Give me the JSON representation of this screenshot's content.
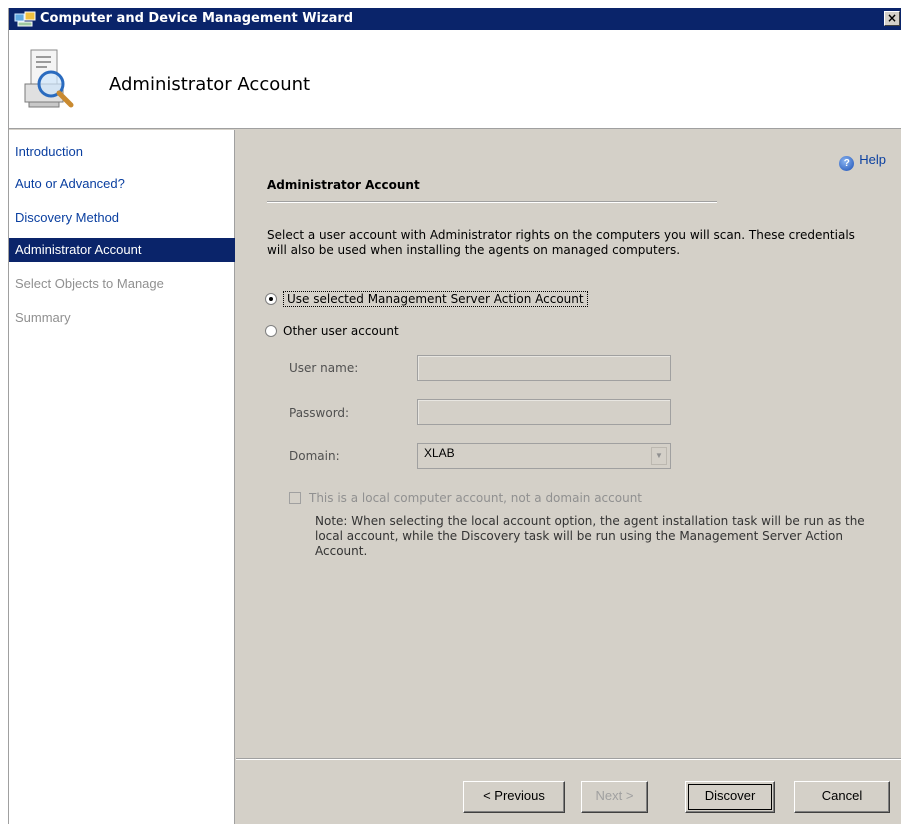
{
  "window": {
    "title": "Computer and Device Management Wizard",
    "close_label": "×",
    "header_title": "Administrator Account"
  },
  "nav": {
    "items": [
      {
        "label": "Introduction",
        "state": "link"
      },
      {
        "label": "Auto or Advanced?",
        "state": "link"
      },
      {
        "label": "Discovery Method",
        "state": "link"
      },
      {
        "label": "Administrator Account",
        "state": "active"
      },
      {
        "label": "Select Objects to Manage",
        "state": "disabled"
      },
      {
        "label": "Summary",
        "state": "disabled"
      }
    ]
  },
  "help": {
    "label": "Help",
    "icon": "help-icon"
  },
  "section": {
    "title": "Administrator Account",
    "description": "Select a user account with Administrator rights on the computers you will scan. These credentials will also be used when installing the agents on managed computers."
  },
  "account_options": [
    {
      "label": "Use selected Management Server Action Account",
      "checked": true
    },
    {
      "label": "Other user account",
      "checked": false
    }
  ],
  "fields": {
    "username": {
      "label": "User name:",
      "value": ""
    },
    "password": {
      "label": "Password:",
      "value": ""
    },
    "domain": {
      "label": "Domain:",
      "value": "XLAB"
    }
  },
  "local_account_checkbox": {
    "label": "This is a local computer account, not a domain account",
    "checked": false
  },
  "note": "Note:  When selecting the local account option, the agent installation task will be run as the local account, while the Discovery task will be run using the Management Server Action Account.",
  "buttons": {
    "previous": "< Previous",
    "next": "Next >",
    "discover": "Discover",
    "cancel": "Cancel"
  },
  "colors": {
    "titlebar": "#0a246a",
    "active_nav": "#0a246a",
    "link": "#0a3fa0",
    "dialog_bg": "#d4d0c8"
  }
}
